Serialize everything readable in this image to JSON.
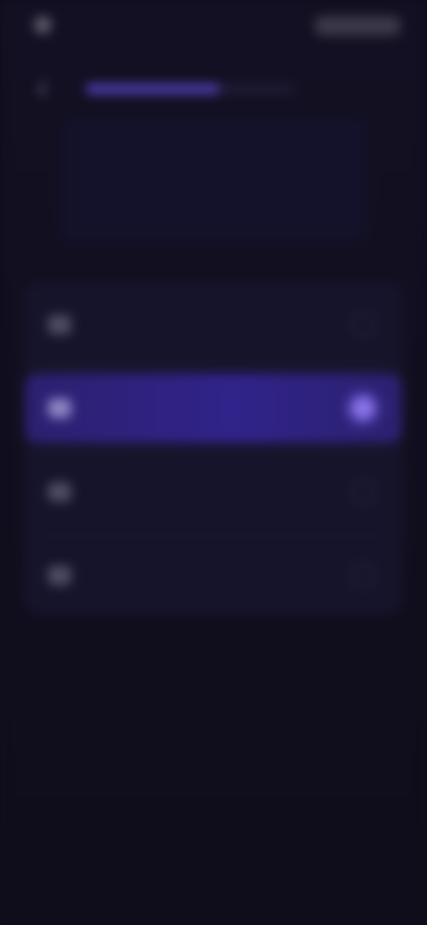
{
  "status_bar": {
    "time": "",
    "icons": [
      "notch-dot",
      "status-pill"
    ]
  },
  "nav": {
    "back_icon": "arrow-left-icon",
    "progress_fraction": 0.64
  },
  "question": {
    "title": "",
    "subtitle": ""
  },
  "options": [
    {
      "badge": "",
      "label": "",
      "selected": false
    },
    {
      "badge": "",
      "label": "",
      "selected": true
    },
    {
      "badge": "",
      "label": "",
      "selected": false
    },
    {
      "badge": "",
      "label": "",
      "selected": false
    }
  ],
  "colors": {
    "background": "#100e1c",
    "accent": "#4b3aa8",
    "selected_row": "#30238a",
    "radio_selected": "#8a74e8"
  }
}
